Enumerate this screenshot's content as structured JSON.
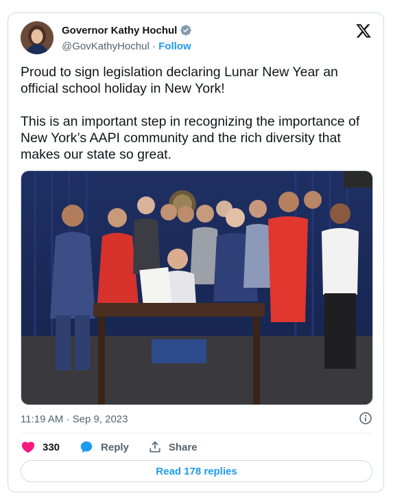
{
  "author": {
    "name": "Governor Kathy Hochul",
    "handle": "@GovKathyHochul",
    "separator": "·",
    "follow_label": "Follow",
    "verified_color": "#829aab"
  },
  "tweet": {
    "text": "Proud to sign legislation declaring Lunar New Year an official school holiday in New York!\n\nThis is an important step in recognizing the importance of New York’s AAPI community and the rich diversity that makes our state so great.",
    "timestamp": "11:19 AM · Sep 9, 2023"
  },
  "actions": {
    "like_count": "330",
    "reply_label": "Reply",
    "share_label": "Share"
  },
  "read_replies_label": "Read 178 replies",
  "colors": {
    "accent": "#1d9bf0",
    "heart": "#f91880",
    "text_secondary": "#536471",
    "border": "#cfd9de"
  },
  "icons": [
    "verified-badge-icon",
    "x-logo-icon",
    "info-icon",
    "heart-icon",
    "reply-icon",
    "share-icon"
  ]
}
